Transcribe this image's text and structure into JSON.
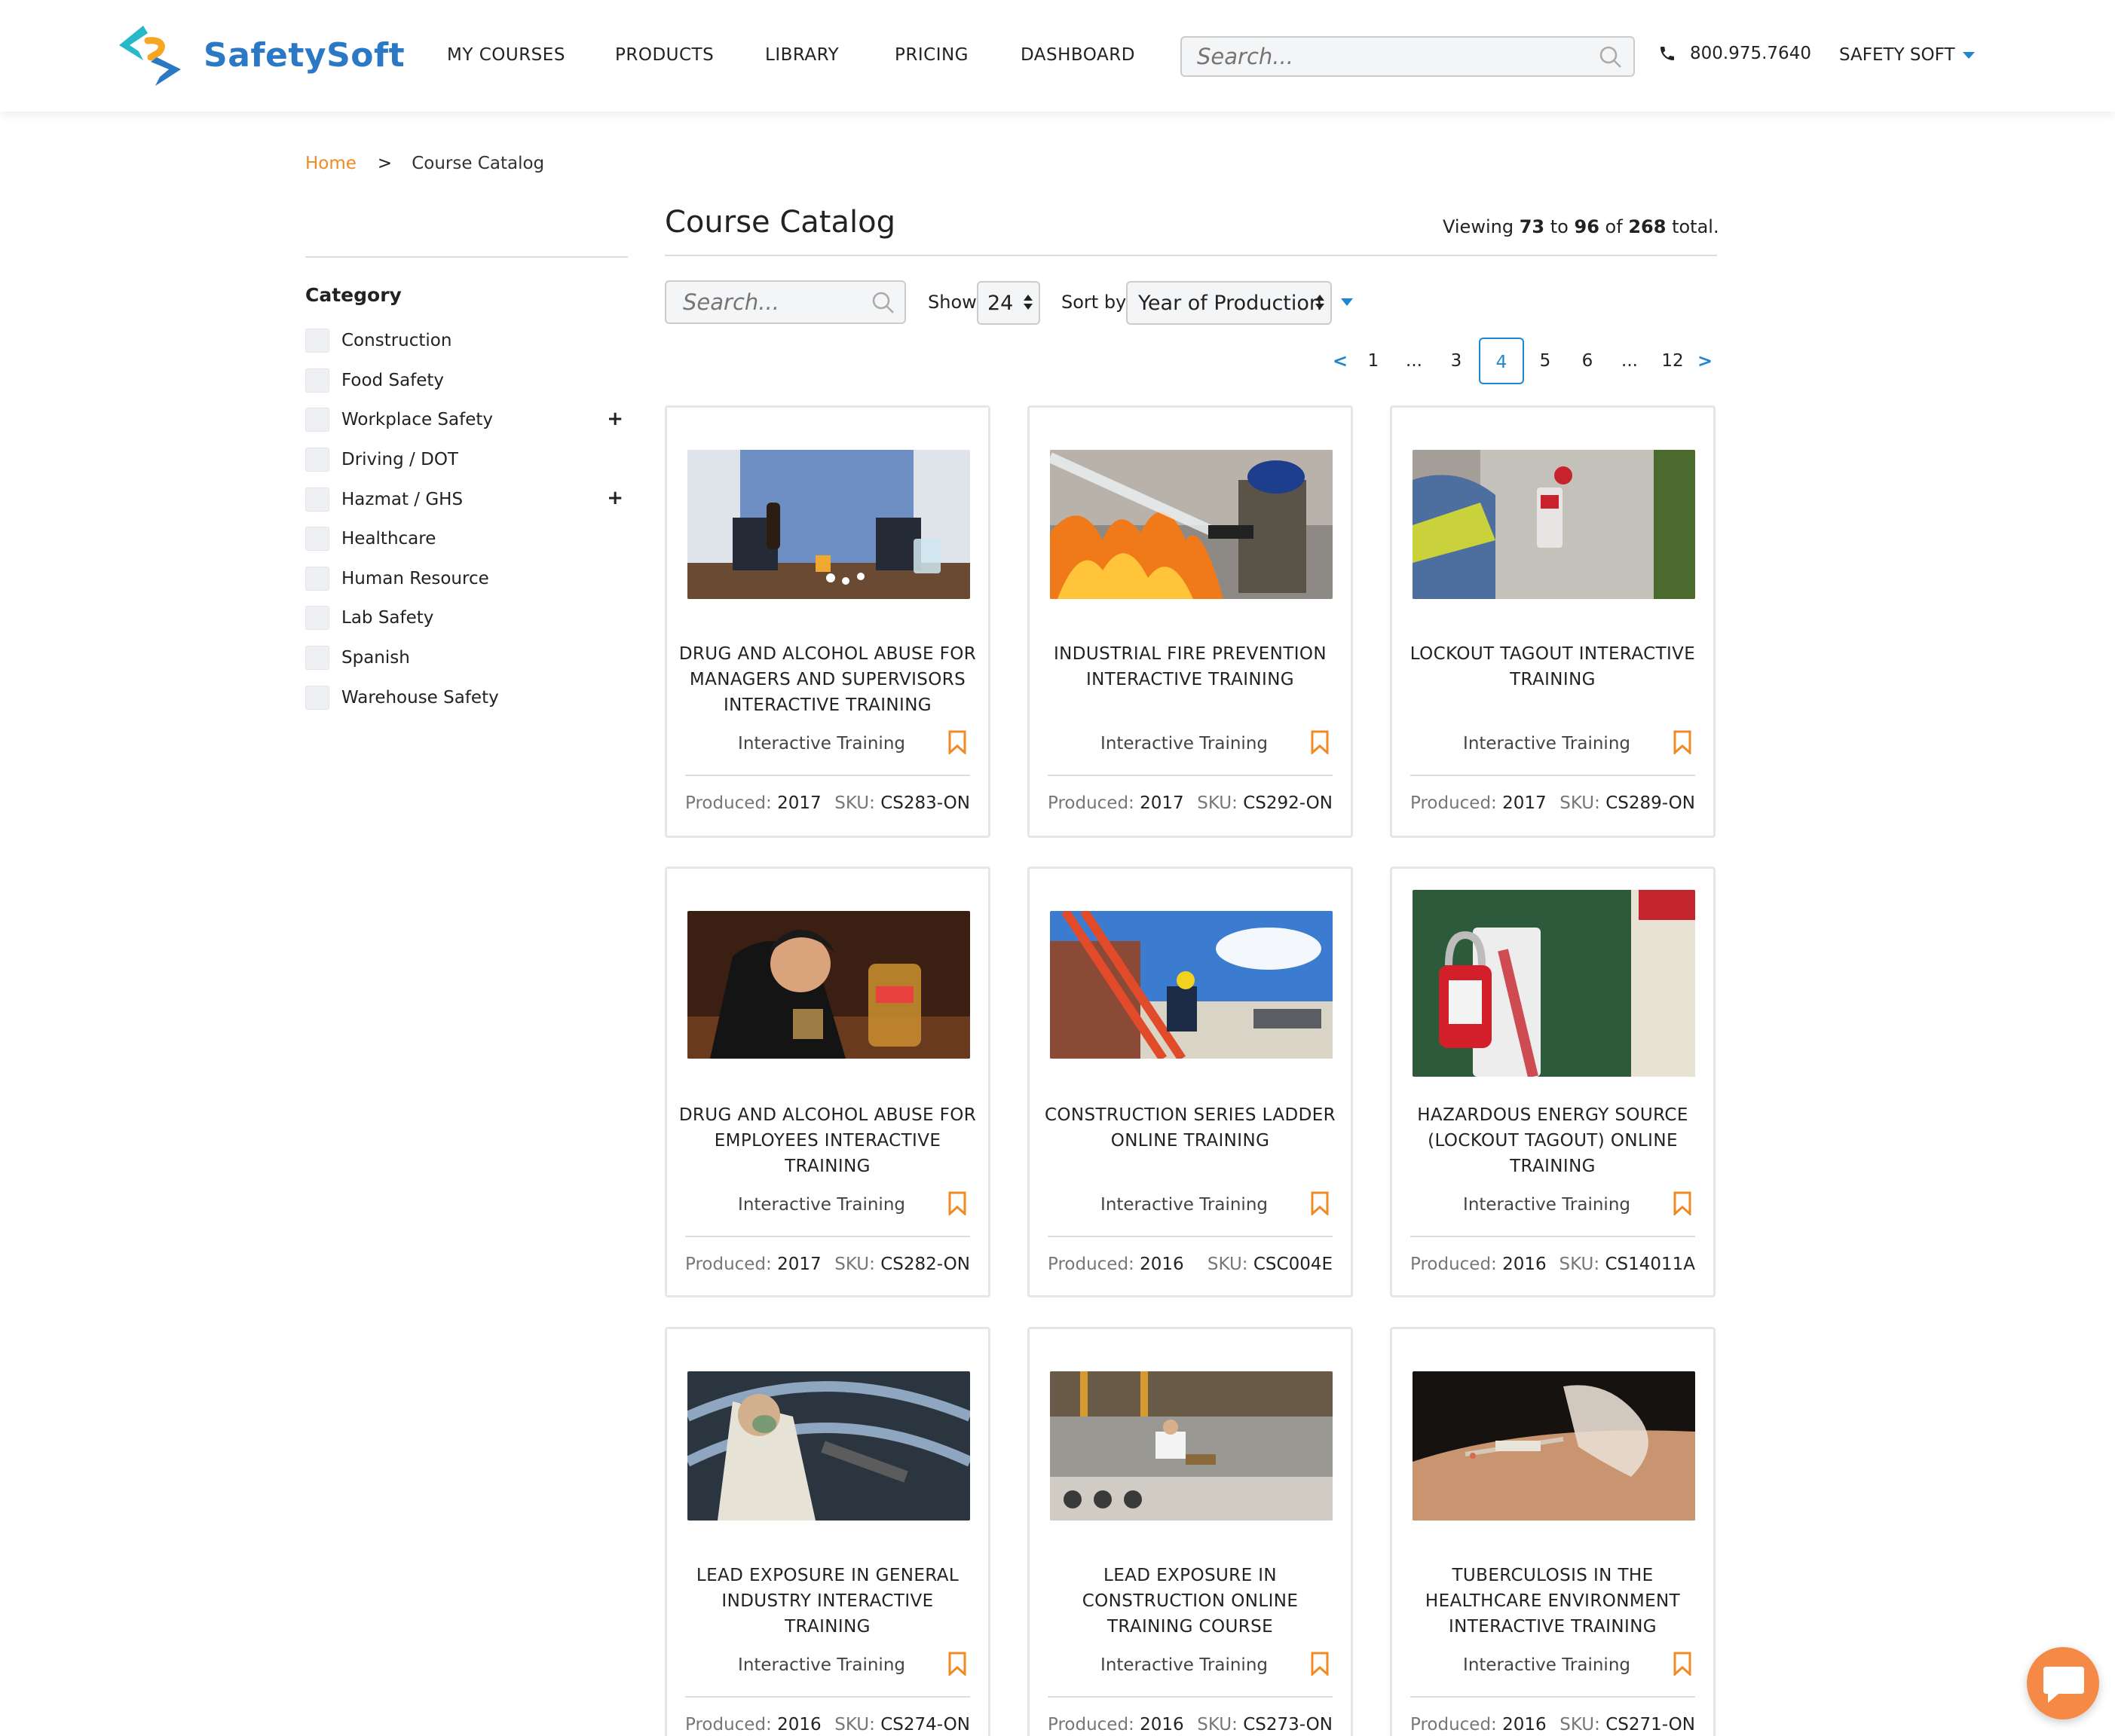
{
  "header": {
    "logo_text": "SafetySoft",
    "nav": [
      "MY COURSES",
      "PRODUCTS",
      "LIBRARY",
      "PRICING",
      "DASHBOARD"
    ],
    "search_placeholder": "Search...",
    "phone": "800.975.7640",
    "account": "SAFETY SOFT"
  },
  "breadcrumb": {
    "home": "Home",
    "separator": ">",
    "current": "Course Catalog"
  },
  "sidebar": {
    "title": "Category",
    "items": [
      {
        "label": "Construction",
        "expandable": false
      },
      {
        "label": "Food Safety",
        "expandable": false
      },
      {
        "label": "Workplace Safety",
        "expandable": true
      },
      {
        "label": "Driving / DOT",
        "expandable": false
      },
      {
        "label": "Hazmat / GHS",
        "expandable": true
      },
      {
        "label": "Healthcare",
        "expandable": false
      },
      {
        "label": "Human Resource",
        "expandable": false
      },
      {
        "label": "Lab Safety",
        "expandable": false
      },
      {
        "label": "Spanish",
        "expandable": false
      },
      {
        "label": "Warehouse Safety",
        "expandable": false
      }
    ],
    "expand_symbol": "+"
  },
  "main": {
    "title": "Course Catalog",
    "viewing": {
      "prefix": "Viewing",
      "from": "73",
      "to_word": "to",
      "to": "96",
      "of_word": "of",
      "total": "268",
      "suffix": "total."
    },
    "filter_search_placeholder": "Search...",
    "show_label": "Show",
    "show_value": "24",
    "sort_label": "Sort by",
    "sort_value": "Year of Production"
  },
  "pagination": {
    "prev": "<",
    "next": ">",
    "active": "4",
    "items": [
      "1",
      "...",
      "3",
      "4",
      "5",
      "6",
      "...",
      "12"
    ]
  },
  "cards": [
    {
      "title": "DRUG AND ALCOHOL ABUSE FOR MANAGERS AND SUPERVISORS INTERACTIVE TRAINING",
      "type": "Interactive Training",
      "produced_label": "Produced:",
      "produced": "2017",
      "sku_label": "SKU:",
      "sku": "CS283-ON"
    },
    {
      "title": "INDUSTRIAL FIRE PREVENTION INTERACTIVE TRAINING",
      "type": "Interactive Training",
      "produced_label": "Produced:",
      "produced": "2017",
      "sku_label": "SKU:",
      "sku": "CS292-ON"
    },
    {
      "title": "LOCKOUT TAGOUT INTERACTIVE TRAINING",
      "type": "Interactive Training",
      "produced_label": "Produced:",
      "produced": "2017",
      "sku_label": "SKU:",
      "sku": "CS289-ON"
    },
    {
      "title": "DRUG AND ALCOHOL ABUSE FOR EMPLOYEES INTERACTIVE TRAINING",
      "type": "Interactive Training",
      "produced_label": "Produced:",
      "produced": "2017",
      "sku_label": "SKU:",
      "sku": "CS282-ON"
    },
    {
      "title": "CONSTRUCTION SERIES LADDER ONLINE TRAINING",
      "type": "Interactive Training",
      "produced_label": "Produced:",
      "produced": "2016",
      "sku_label": "SKU:",
      "sku": "CSC004E"
    },
    {
      "title": "HAZARDOUS ENERGY SOURCE (LOCKOUT TAGOUT) ONLINE TRAINING",
      "type": "Interactive Training",
      "produced_label": "Produced:",
      "produced": "2016",
      "sku_label": "SKU:",
      "sku": "CS14011A"
    },
    {
      "title": "LEAD EXPOSURE IN GENERAL INDUSTRY INTERACTIVE TRAINING",
      "type": "Interactive Training",
      "produced_label": "Produced:",
      "produced": "2016",
      "sku_label": "SKU:",
      "sku": "CS274-ON"
    },
    {
      "title": "LEAD EXPOSURE IN CONSTRUCTION ONLINE TRAINING COURSE",
      "type": "Interactive Training",
      "produced_label": "Produced:",
      "produced": "2016",
      "sku_label": "SKU:",
      "sku": "CS273-ON"
    },
    {
      "title": "TUBERCULOSIS IN THE HEALTHCARE ENVIRONMENT INTERACTIVE TRAINING",
      "type": "Interactive Training",
      "produced_label": "Produced:",
      "produced": "2016",
      "sku_label": "SKU:",
      "sku": "CS271-ON"
    }
  ],
  "colors": {
    "accent_orange": "#f08a24",
    "link_blue": "#1f86d0",
    "logo_blue": "#2b78c5",
    "chat": "#f58a46"
  },
  "icons": {
    "search": "search-icon",
    "phone": "phone-icon",
    "bookmark": "bookmark-icon",
    "chat": "chat-icon"
  }
}
